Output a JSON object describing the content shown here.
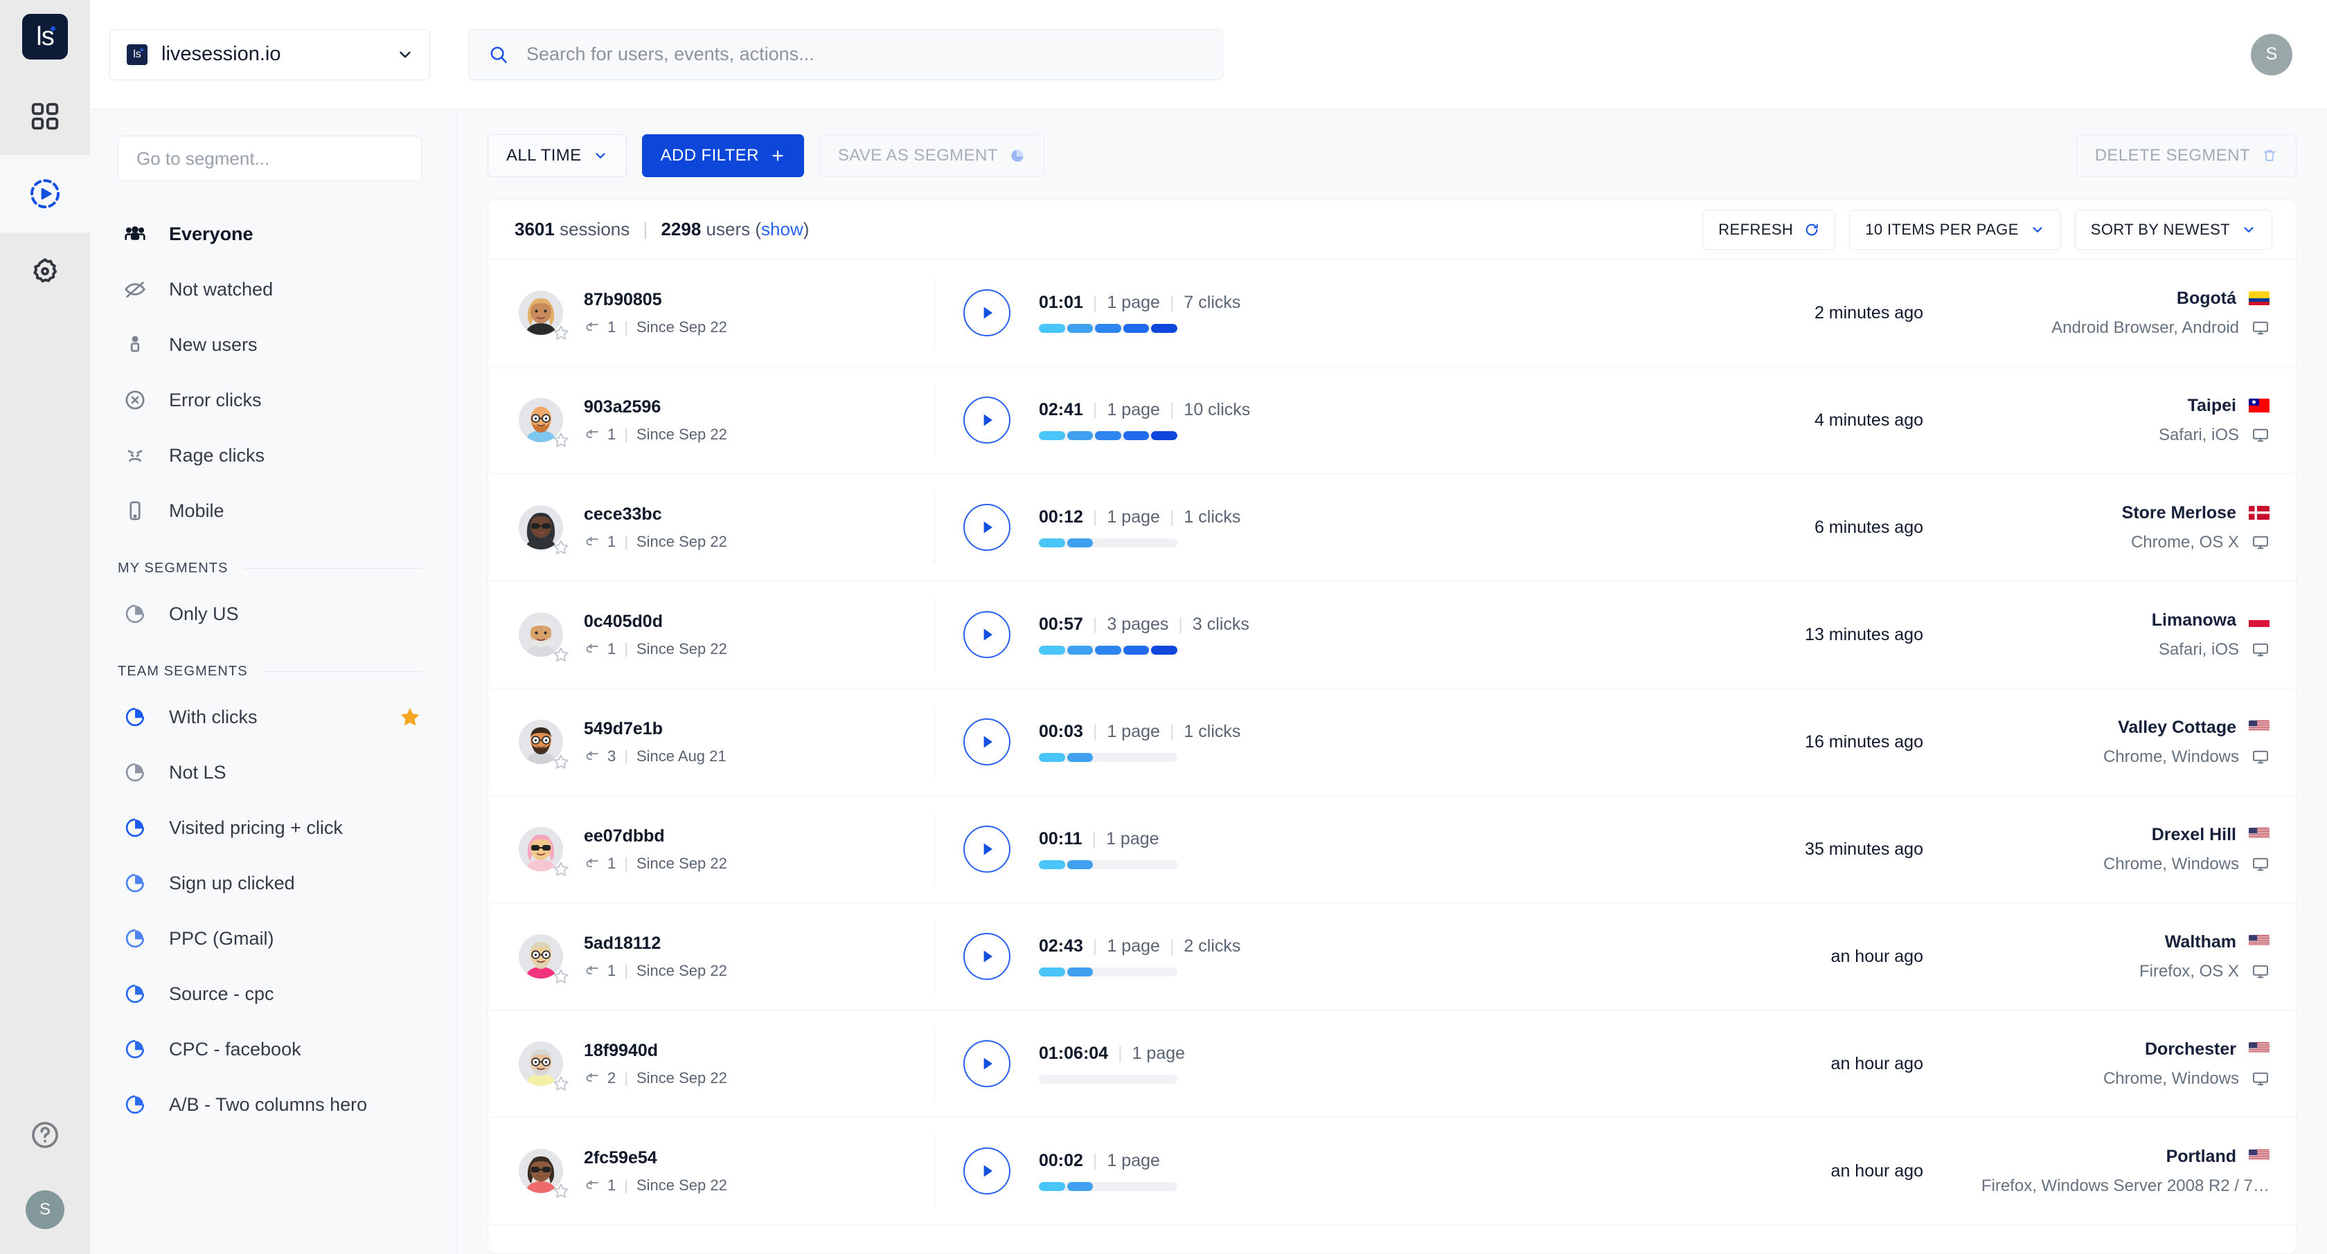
{
  "rail": {
    "logo_text": "ls",
    "items": [
      {
        "name": "apps-grid-icon",
        "active": false
      },
      {
        "name": "session-replay-icon",
        "active": true
      },
      {
        "name": "gear-icon",
        "active": false
      }
    ],
    "help_label": "?",
    "user_initial": "S"
  },
  "topbar": {
    "site_badge": "ls",
    "site_name": "livesession.io",
    "search_placeholder": "Search for users, events, actions...",
    "avatar_initial": "S"
  },
  "sidebar": {
    "search_placeholder": "Go to segment...",
    "default_items": [
      {
        "label": "Everyone",
        "icon": "people-icon",
        "selected": true
      },
      {
        "label": "Not watched",
        "icon": "eye-off-icon",
        "selected": false
      },
      {
        "label": "New users",
        "icon": "person-icon",
        "selected": false
      },
      {
        "label": "Error clicks",
        "icon": "x-circle-icon",
        "selected": false
      },
      {
        "label": "Rage clicks",
        "icon": "angry-face-icon",
        "selected": false
      },
      {
        "label": "Mobile",
        "icon": "mobile-icon",
        "selected": false
      }
    ],
    "my_segments_title": "MY SEGMENTS",
    "my_segments": [
      {
        "label": "Only US",
        "icon": "pie-chart-icon",
        "color": "#8e96a3",
        "starred": false
      }
    ],
    "team_segments_title": "TEAM SEGMENTS",
    "team_segments": [
      {
        "label": "With clicks",
        "icon": "pie-chart-icon",
        "color": "#1c5bef",
        "starred": true
      },
      {
        "label": "Not LS",
        "icon": "pie-chart-icon",
        "color": "#8e96a3",
        "starred": false
      },
      {
        "label": "Visited pricing + click",
        "icon": "pie-chart-icon",
        "color": "#1c5bef",
        "starred": false
      },
      {
        "label": "Sign up clicked",
        "icon": "pie-chart-icon",
        "color": "#4d83f2",
        "starred": false
      },
      {
        "label": "PPC (Gmail)",
        "icon": "pie-chart-icon",
        "color": "#4d83f2",
        "starred": false
      },
      {
        "label": "Source - cpc",
        "icon": "pie-chart-icon",
        "color": "#2a6bf0",
        "starred": false
      },
      {
        "label": "CPC - facebook",
        "icon": "pie-chart-icon",
        "color": "#2a6bf0",
        "starred": false
      },
      {
        "label": "A/B - Two columns hero",
        "icon": "pie-chart-icon",
        "color": "#2a6bf0",
        "starred": false
      }
    ]
  },
  "filterbar": {
    "time_range": "ALL TIME",
    "add_filter": "ADD FILTER",
    "save_as_segment": "SAVE AS SEGMENT",
    "delete_segment": "DELETE SEGMENT"
  },
  "card_head": {
    "sessions_count": "3601",
    "sessions_word": "sessions",
    "users_count": "2298",
    "users_word": "users",
    "show_link": "show",
    "refresh": "REFRESH",
    "items_per_page": "10 ITEMS PER PAGE",
    "sort": "SORT BY NEWEST"
  },
  "colors": {
    "accent": "#0d47d9",
    "link": "#2a63f0",
    "star": "#f5a623",
    "engage_1": "#49c5f7",
    "engage_2": "#3fa0f0",
    "engage_3": "#2f85ef",
    "engage_4": "#1f6bec",
    "engage_5": "#0f46dc",
    "engage_empty": "#f0f1f4"
  },
  "sessions": [
    {
      "user_id": "87b90805",
      "returns": "1",
      "since": "Since Sep 22",
      "duration": "01:01",
      "pages": "1 page",
      "clicks": "7 clicks",
      "engagement": 5,
      "time_ago": "2 minutes ago",
      "city": "Bogotá",
      "device": "Android Browser, Android",
      "country": "Colombia",
      "avatar": "woman-blonde"
    },
    {
      "user_id": "903a2596",
      "returns": "1",
      "since": "Since Sep 22",
      "duration": "02:41",
      "pages": "1 page",
      "clicks": "10 clicks",
      "engagement": 5,
      "time_ago": "4 minutes ago",
      "city": "Taipei",
      "device": "Safari, iOS",
      "country": "Taiwan",
      "avatar": "man-beard-glasses"
    },
    {
      "user_id": "cece33bc",
      "returns": "1",
      "since": "Since Sep 22",
      "duration": "00:12",
      "pages": "1 page",
      "clicks": "1 clicks",
      "engagement": 2,
      "time_ago": "6 minutes ago",
      "city": "Store Merlose",
      "device": "Chrome, OS X",
      "country": "Denmark",
      "avatar": "woman-hijab-sunglasses"
    },
    {
      "user_id": "0c405d0d",
      "returns": "1",
      "since": "Since Sep 22",
      "duration": "00:57",
      "pages": "3 pages",
      "clicks": "3 clicks",
      "engagement": 5,
      "time_ago": "13 minutes ago",
      "city": "Limanowa",
      "device": "Safari, iOS",
      "country": "Poland",
      "avatar": "man-white-hair"
    },
    {
      "user_id": "549d7e1b",
      "returns": "3",
      "since": "Since Aug 21",
      "duration": "00:03",
      "pages": "1 page",
      "clicks": "1 clicks",
      "engagement": 2,
      "time_ago": "16 minutes ago",
      "city": "Valley Cottage",
      "device": "Chrome, Windows",
      "country": "United States",
      "avatar": "man-dark-glasses"
    },
    {
      "user_id": "ee07dbbd",
      "returns": "1",
      "since": "Since Sep 22",
      "duration": "00:11",
      "pages": "1 page",
      "clicks": "",
      "engagement": 2,
      "time_ago": "35 minutes ago",
      "city": "Drexel Hill",
      "device": "Chrome, Windows",
      "country": "United States",
      "avatar": "woman-pink-hair"
    },
    {
      "user_id": "5ad18112",
      "returns": "1",
      "since": "Since Sep 22",
      "duration": "02:43",
      "pages": "1 page",
      "clicks": "2 clicks",
      "engagement": 2,
      "time_ago": "an hour ago",
      "city": "Waltham",
      "device": "Firefox, OS X",
      "country": "United States",
      "avatar": "man-blond-beard"
    },
    {
      "user_id": "18f9940d",
      "returns": "2",
      "since": "Since Sep 22",
      "duration": "01:06:04",
      "pages": "1 page",
      "clicks": "",
      "engagement": 0,
      "time_ago": "an hour ago",
      "city": "Dorchester",
      "device": "Chrome, Windows",
      "country": "United States",
      "avatar": "man-grey-glasses"
    },
    {
      "user_id": "2fc59e54",
      "returns": "1",
      "since": "Since Sep 22",
      "duration": "00:02",
      "pages": "1 page",
      "clicks": "",
      "engagement": 2,
      "time_ago": "an hour ago",
      "city": "Portland",
      "device": "Firefox, Windows Server 2008 R2 / 7…",
      "country": "United States",
      "avatar": "woman-sunglasses-dark"
    }
  ]
}
